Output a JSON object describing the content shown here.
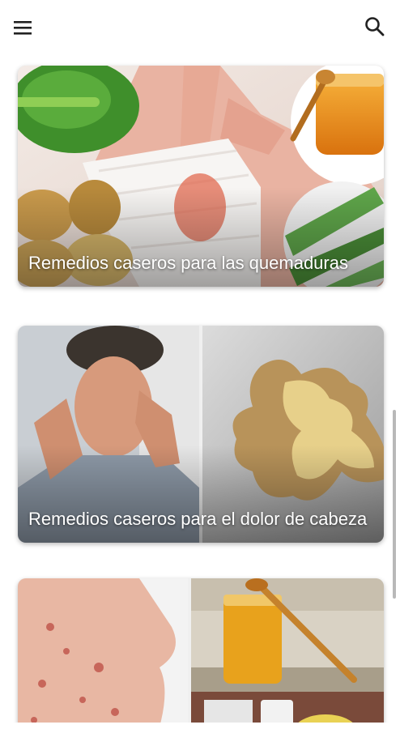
{
  "appbar": {
    "menu_icon": "hamburger-menu-icon",
    "search_icon": "search-icon"
  },
  "cards": [
    {
      "title": "Remedios caseros para las quemaduras"
    },
    {
      "title": "Remedios caseros para el dolor de cabeza"
    },
    {
      "title": ""
    }
  ],
  "colors": {
    "background": "#ffffff",
    "icon": "#212121",
    "title_text": "#ffffff"
  }
}
